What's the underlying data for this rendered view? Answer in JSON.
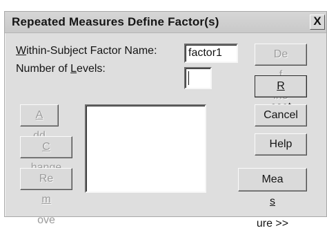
{
  "window": {
    "title": "Repeated Measures Define Factor(s)",
    "close_glyph": "X"
  },
  "form": {
    "factor_name_label_pre": "",
    "factor_name_label_key": "W",
    "factor_name_label_post": "ithin-Subject Factor Name:",
    "factor_name_value": "factor1",
    "levels_label_pre": "Number of ",
    "levels_label_key": "L",
    "levels_label_post": "evels:",
    "levels_value": ""
  },
  "left_buttons": {
    "add": {
      "pre": "",
      "key": "A",
      "post": "dd"
    },
    "change": {
      "pre": "",
      "key": "C",
      "post": "hange"
    },
    "remove": {
      "pre": "Re",
      "key": "m",
      "post": "ove"
    }
  },
  "right_buttons": {
    "define": {
      "pre": "De",
      "key": "f",
      "post": "ine"
    },
    "reset": {
      "pre": "",
      "key": "R",
      "post": "eset"
    },
    "cancel": {
      "label": "Cancel"
    },
    "help": {
      "label": "Help"
    },
    "measure": {
      "pre": "Mea",
      "key": "s",
      "post": "ure >>"
    }
  },
  "factor_list": []
}
